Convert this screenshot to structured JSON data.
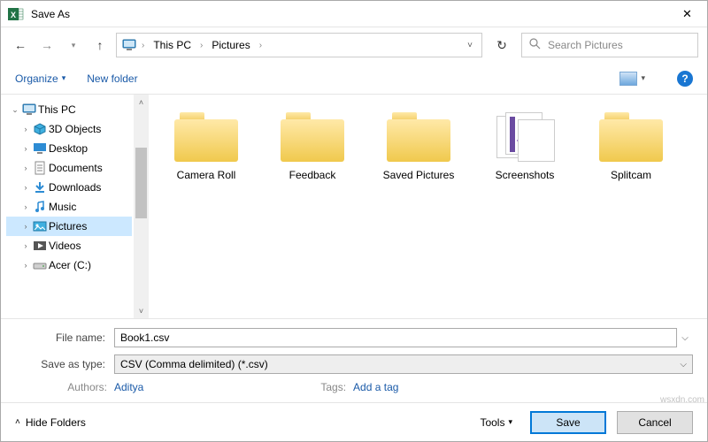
{
  "title": "Save As",
  "breadcrumb": {
    "root": "This PC",
    "current": "Pictures"
  },
  "search_placeholder": "Search Pictures",
  "toolbar": {
    "organize": "Organize",
    "new_folder": "New folder"
  },
  "tree": {
    "root": "This PC",
    "items": [
      {
        "label": "3D Objects",
        "icon": "3d"
      },
      {
        "label": "Desktop",
        "icon": "desktop"
      },
      {
        "label": "Documents",
        "icon": "docs"
      },
      {
        "label": "Downloads",
        "icon": "dl"
      },
      {
        "label": "Music",
        "icon": "music"
      },
      {
        "label": "Pictures",
        "icon": "pics",
        "selected": true
      },
      {
        "label": "Videos",
        "icon": "vid"
      },
      {
        "label": "Acer (C:)",
        "icon": "drive"
      }
    ]
  },
  "folders": [
    {
      "label": "Camera Roll",
      "type": "folder"
    },
    {
      "label": "Feedback",
      "type": "folder"
    },
    {
      "label": "Saved Pictures",
      "type": "folder"
    },
    {
      "label": "Screenshots",
      "type": "shots"
    },
    {
      "label": "Splitcam",
      "type": "folder"
    }
  ],
  "file_name_label": "File name:",
  "file_name": "Book1.csv",
  "save_type_label": "Save as type:",
  "save_type": "CSV (Comma delimited) (*.csv)",
  "meta": {
    "authors_label": "Authors:",
    "authors_value": "Aditya",
    "tags_label": "Tags:",
    "tags_value": "Add a tag"
  },
  "footer": {
    "hide_folders": "Hide Folders",
    "tools": "Tools",
    "save": "Save",
    "cancel": "Cancel"
  },
  "watermark": "wsxdn.com"
}
